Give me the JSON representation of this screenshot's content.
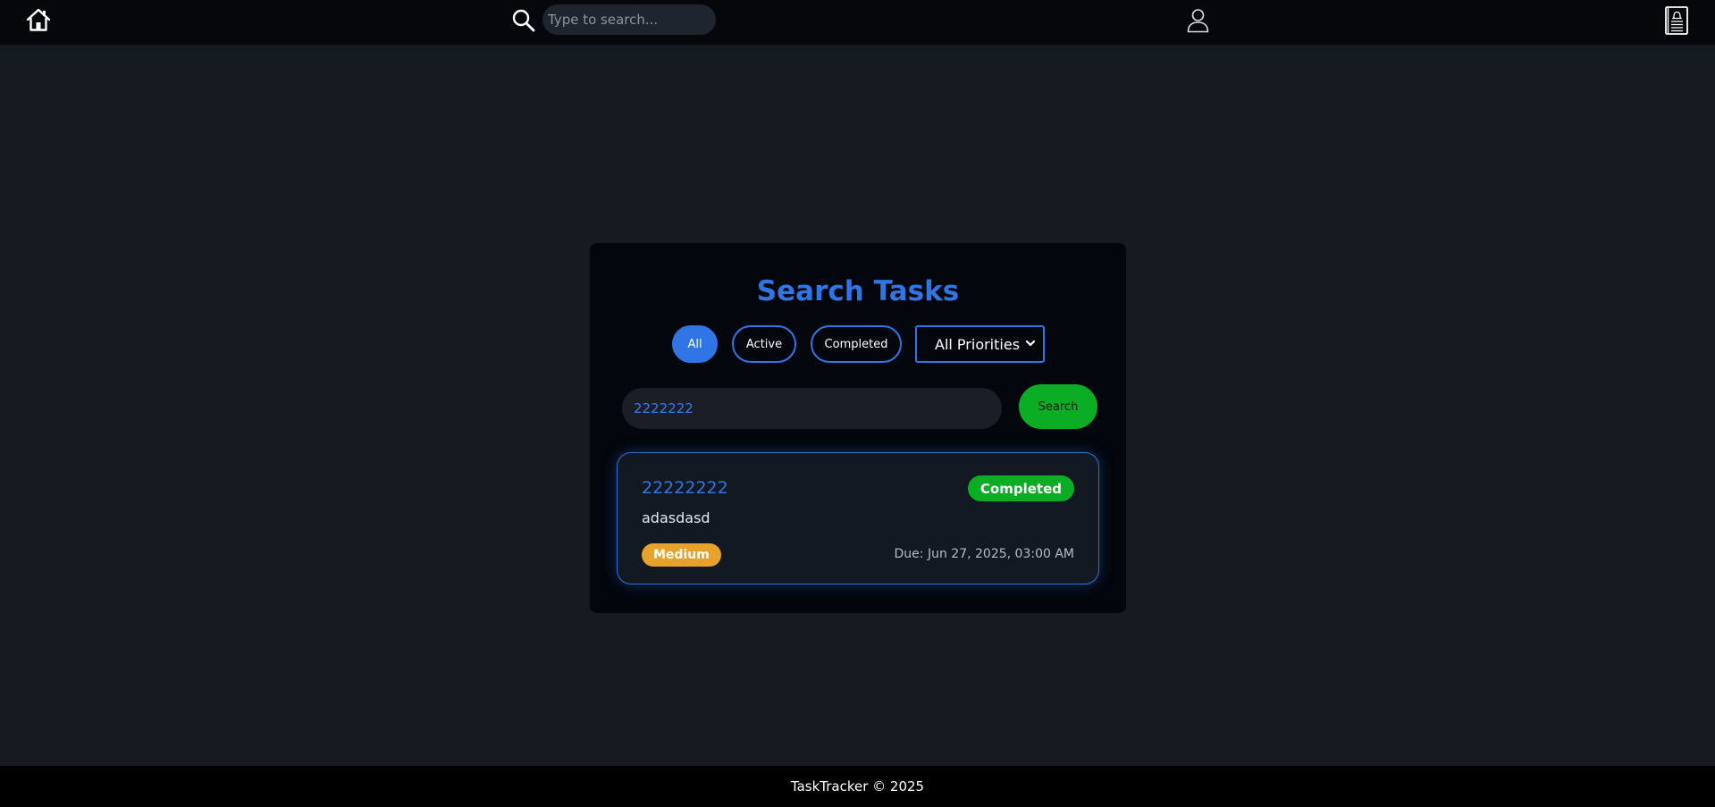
{
  "nav": {
    "icons": [
      "home-icon",
      "search-icon",
      "user-icon",
      "notebook-icon"
    ],
    "search_placeholder": "Type to search..."
  },
  "main": {
    "title": "Search Tasks",
    "filters": {
      "all_label": "All",
      "active_label": "Active",
      "completed_label": "Completed",
      "selected": "All"
    },
    "priority_select": {
      "value": "All Priorities"
    },
    "search": {
      "value": "2222222",
      "button_label": "Search"
    },
    "results": [
      {
        "title": "22222222",
        "status": "Completed",
        "description": "adasdasd",
        "priority": "Medium",
        "due": "Due: Jun 27, 2025, 03:00 AM"
      }
    ]
  },
  "footer": {
    "text": "TaskTracker © 2025"
  },
  "colors": {
    "accent": "#2f75e4",
    "success": "#0bad24",
    "warning": "#e7a22c",
    "background": "#161b22",
    "nav_background": "#05070b"
  }
}
